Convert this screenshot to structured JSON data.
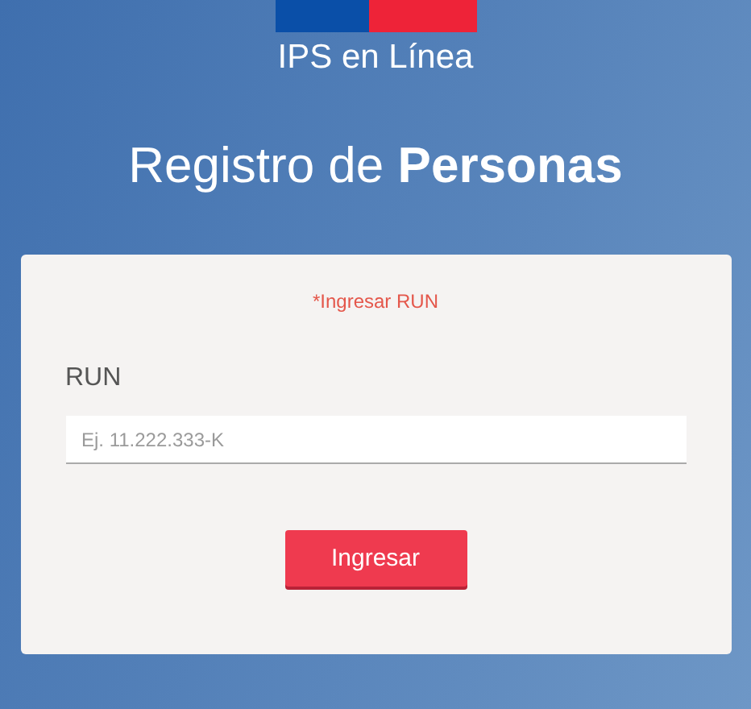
{
  "brand": {
    "name": "IPS en Línea"
  },
  "heading": "Registro de **Personas**",
  "form": {
    "error": "*Ingresar RUN",
    "label": "RUN",
    "placeholder": "Ej. 11.222.333-K",
    "submit": "Ingresar"
  }
}
